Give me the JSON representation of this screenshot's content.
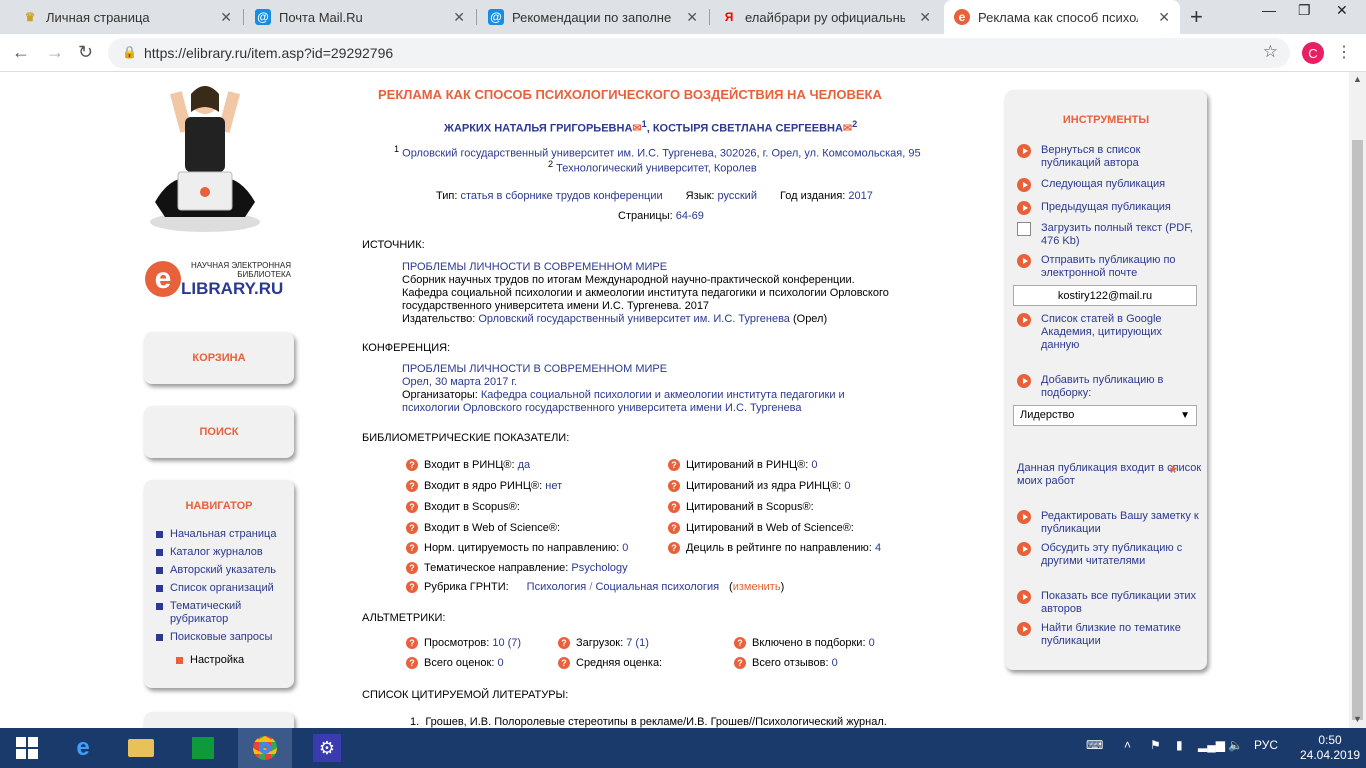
{
  "browser": {
    "tabs": [
      {
        "title": "Личная страница",
        "icon": "crown-icon",
        "active": false
      },
      {
        "title": "Почта Mail.Ru",
        "icon": "at-icon",
        "active": false
      },
      {
        "title": "Рекомендации по заполнени",
        "icon": "at-icon",
        "active": false
      },
      {
        "title": "елайбрари ру официальный с",
        "icon": "yandex-icon",
        "active": false
      },
      {
        "title": "Реклама как способ психолог",
        "icon": "elibrary-icon",
        "active": true
      }
    ],
    "new_tab": "+",
    "url": "https://elibrary.ru/item.asp?id=29292796",
    "profile_initial": "C"
  },
  "sidebar": {
    "logo_small": "НАУЧНАЯ ЭЛЕКТРОННАЯ БИБЛИОТЕКА",
    "logo_big": "LIBRARY.RU",
    "logo_letter": "e",
    "cart": "КОРЗИНА",
    "search": "ПОИСК",
    "navigator_title": "НАВИГАТОР",
    "nav_items": [
      "Начальная страница",
      "Каталог журналов",
      "Авторский указатель",
      "Список организаций",
      "Тематический рубрикатор",
      "Поисковые запросы"
    ],
    "settings": "Настройка"
  },
  "article": {
    "title": "РЕКЛАМА КАК СПОСОБ ПСИХОЛОГИЧЕСКОГО ВОЗДЕЙСТВИЯ НА ЧЕЛОВЕКА",
    "author1": "ЖАРКИХ НАТАЛЬЯ ГРИГОРЬЕВНА",
    "author1_sup": "1",
    "author2": "КОСТЫРЯ СВЕТЛАНА СЕРГЕЕВНА",
    "author2_sup": "2",
    "aff1_num": "1",
    "aff1": "Орловский государственный университет им. И.С. Тургенева, 302026, г. Орел, ул. Комсомольская, 95",
    "aff2_num": "2",
    "aff2": "Технологический университет, Королев",
    "type_label": "Тип:",
    "type_value": "статья в сборнике трудов конференции",
    "lang_label": "Язык:",
    "lang_value": "русский",
    "year_label": "Год издания:",
    "year_value": "2017",
    "pages_label": "Страницы:",
    "pages_value": "64-69",
    "source_title": "ИСТОЧНИК:",
    "source_link": "ПРОБЛЕМЫ ЛИЧНОСТИ В СОВРЕМЕННОМ МИРЕ",
    "source_desc": "Сборник научных трудов по итогам Международной научно-практической конференции. Кафедра социальной психологии и акмеологии института педагогики и психологии Орловского государственного университета имени И.С. Тургенева. 2017",
    "publisher_label": "Издательство:",
    "publisher_value": "Орловский государственный университет им. И.С. Тургенева",
    "publisher_city": "(Орел)",
    "conf_title": "КОНФЕРЕНЦИЯ:",
    "conf_link": "ПРОБЛЕМЫ ЛИЧНОСТИ В СОВРЕМЕННОМ МИРЕ",
    "conf_place": "Орел, 30 марта 2017 г.",
    "conf_org_label": "Организаторы:",
    "conf_org_value": "Кафедра социальной психологии и акмеологии института педагогики и психологии Орловского государственного университета имени И.С. Тургенева",
    "biblio_title": "БИБЛИОМЕТРИЧЕСКИЕ ПОКАЗАТЕЛИ:",
    "m1_label": "Входит в РИНЦ®:",
    "m1_value": "да",
    "m2_label": "Входит в ядро РИНЦ®:",
    "m2_value": "нет",
    "m3_label": "Входит в Scopus®:",
    "m4_label": "Входит в Web of Science®:",
    "m5_label": "Норм. цитируемость по направлению:",
    "m5_value": "0",
    "m6_label": "Тематическое направление:",
    "m6_value": "Psychology",
    "m7_label": "Рубрика ГРНТИ:",
    "m7_value1": "Психология",
    "m7_sep": "/",
    "m7_value2": "Социальная психология",
    "m7_change_open": "(",
    "m7_change": "изменить",
    "m7_change_close": ")",
    "c1_label": "Цитирований в РИНЦ®:",
    "c1_value": "0",
    "c2_label": "Цитирований из ядра РИНЦ®:",
    "c2_value": "0",
    "c3_label": "Цитирований в Scopus®:",
    "c4_label": "Цитирований в Web of Science®:",
    "c5_label": "Дециль в рейтинге по направлению:",
    "c5_value": "4",
    "alt_title": "АЛЬТМЕТРИКИ:",
    "a1_label": "Просмотров:",
    "a1_value": "10 (7)",
    "a2_label": "Загрузок:",
    "a2_value": "7 (1)",
    "a3_label": "Включено в подборки:",
    "a3_value": "0",
    "a4_label": "Всего оценок:",
    "a4_value": "0",
    "a5_label": "Средняя оценка:",
    "a6_label": "Всего отзывов:",
    "a6_value": "0",
    "refs_title": "СПИСОК ЦИТИРУЕМОЙ ЛИТЕРАТУРЫ:",
    "ref1_num": "1.",
    "ref1_text": "Грошев, И.В. Полоролевые стереотипы в рекламе/И.В. Грошев//Психологический журнал."
  },
  "tools": {
    "title": "ИНСТРУМЕНТЫ",
    "t1": "Вернуться в список публикаций автора",
    "t2": "Следующая публикация",
    "t3": "Предыдущая публикация",
    "t4": "Загрузить полный текст (PDF, 476 Kb)",
    "t5": "Отправить публикацию по электронной почте",
    "email": "kostiry122@mail.ru",
    "t6": "Список статей в Google Академия, цитирующих данную",
    "t7": "Добавить публикацию в подборку:",
    "select_value": "Лидерство",
    "t8": "Данная публикация входит в список моих работ",
    "t9": "Редактировать Вашу заметку к публикации",
    "t10": "Обсудить эту публикацию с другими читателями",
    "t11": "Показать все публикации этих авторов",
    "t12": "Найти близкие по тематике публикации"
  },
  "taskbar": {
    "lang": "РУС",
    "time": "0:50",
    "date": "24.04.2019"
  }
}
